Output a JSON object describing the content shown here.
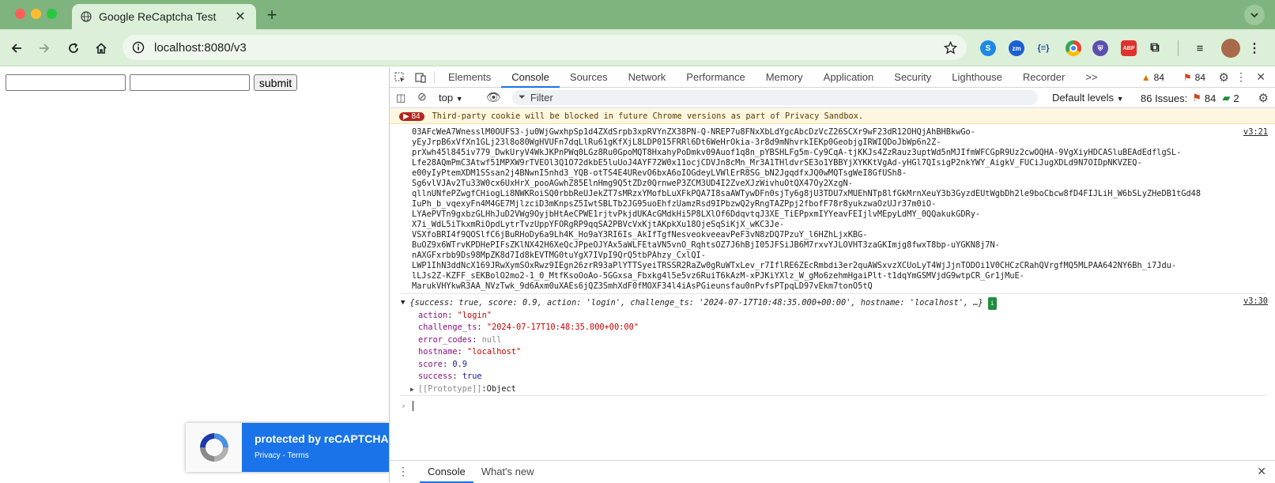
{
  "browser": {
    "tab_title": "Google ReCaptcha Test",
    "url": "localhost:8080/v3"
  },
  "page": {
    "submit_label": "submit",
    "recaptcha": {
      "title": "protected by reCAPTCHA",
      "links": "Privacy - Terms"
    }
  },
  "devtools": {
    "tabs": [
      "Elements",
      "Console",
      "Sources",
      "Network",
      "Performance",
      "Memory",
      "Application",
      "Security",
      "Lighthouse",
      "Recorder"
    ],
    "more_tabs": ">>",
    "warnings_count": "84",
    "errors_count": "84",
    "context": "top",
    "filter_placeholder": "Filter",
    "levels": "Default levels",
    "issues_label": "86 Issues:",
    "issues_errors": "84",
    "issues_info": "2",
    "cookie_badge": "84",
    "cookie_message": "Third-party cookie will be blocked in future Chrome versions as part of Privacy Sandbox.",
    "token_source": "v3:21",
    "token_lines": [
      "03AFcWeA7WnesslM0OUFS3-ju0WjGwxhpSp1d4ZXdSrpb3xpRVYnZX38PN-Q-NREP7u8FNxXbLdYgcAbcDzVcZ26SCXr9wF23dR12OHQjAhBHBkwGo-",
      "yEyJrpB6xVfXn1GLj23l8o80WgHVUFn7dqLlRu61gKfXjL8LDP015FRRl6Dt6WeHrOkia-3r8d9mNhvrkIEKp0GeobjgIRWIQDoJbWp6n2Z-",
      "prXwh45l845iv779_DwkUryV4WkJKPnPWq0LGz8Ru0GpoMQT8HxahyPoDmkv09Auof1q8n_pYBSHLFg5m-Cy9CqA-tjKKJs4ZzRauz3uptWd5nMJIfmWFCGpR9Uz2cwOQHA-9VgXiyHDCASluBEAdEdflgSL-",
      "Lfe28AQmPmC3Atwf51MPXW9rTVEOl3Q1O72dkbE5luUoJ4AYF72W0x11ocjCDVJn8cMn_Mr3A1THldvrSE3o1YBBYjXYKKtVgAd-yHGl7QIsigP2nkYWY_AigkV_FUCiJugXDLd9N7OIDpNKVZEQ-",
      "e00yIyPtemXDM1SSsan2j4BNwnI5nhd3_YQB-otTS4E4URevO6bxA6oIOGdeyLVWlErR8SG_bN2JgqdfxJQ0wMQTsgWeI8GfUSh8-",
      "Sg6vlVJAv2Tu33W0cx6UxHrX_pooAGwhZ85ElnHmg9Q5tZDz0QrnweP3ZCM3UD4I2ZveXJzWivhuOtQX47Oy2XzgN-",
      "qllnUNfePZwgfCHiogLi8NWKRoiSQ0rbbReUJekZT7sMRzxYMofbLuXFkPQA7I8saAWTywDFn0sjTy6g8jU3TDU7xMUEhNTp8lfGkMrnXeuY3b3GyzdEUtWgbDh2le9boCbcw8fD4FIJLiH_W6bSLyZHeDB1tGd48",
      "IuPh_b_vqexyFn4M4GE7MjlzciD3mKnpsZ5IwtSBLTb2JG95uoEhfzUamzRsd9IPbzwQ2yRngTAZPpj2fbofF78r8yukzwaOzUJr37m0iO-",
      "LYAePVTn9gxbzGLHhJuD2VWg9OyjbHtAeCPWE1rjtvPkjdUKAcGMdkHi5P8LXlOf6DdqvtqJ3XE_TiEPpxmIYYeavFEIjlvMEpyLdMY_0QQakukGDRy-",
      "X7i_WdL5iTkxmRiOpdLytrTvzUppYFORgRP9qqSA2PBVcVxKjtAKpkXu18OjeSqSiKjX_wKC3Je-",
      "VSXfoBRI4f9QOSlfC6jBuRHoDy6a9Lh4K_Ho9aY3RI6Is_AkIfTgfNesveokveeavPeF3vN8zDQ7PzuY_l6HZhLjxKBG-",
      "BuOZ9x6WTrvKPDHePIFsZKlNX42H6XeQcJPpeOJYAx5aWLFEtaVN5vnO_RqhtsOZ7J6hBjI05JFSiJB6M7rxvYJLOVHT3zaGKImjg8fwxT8bp-uYGKN8j7N-",
      "nAXGFxrbb9Ds98MpZK8d7Id8kEVTMG0tuYgX7IVpI9QrQ5tbPAhzy_CxlQI-",
      "LWP1IhN3ddNcX169JRwXymSOxRwz9IEgn26zrR93aPlYTTSyeiTRSSR2RaZw0gRuWTxLev_r7IflRE6ZEcRmbdi3er2quAWSxvzXCUoLyT4WjJjnTODOi1V0CHCzCRahQVrgfMQ5MLPAA642NY6Bh_i7Jdu-",
      "lLJs2Z-KZFF_sEKBolO2mo2-1_0_MtfKsoOoAo-5GGxsa_Fbxkg4l5e5vz6RuiT6kAzM-xPJKiYXlz_W_gMo6zehmHgaiPlt-t1dqYmGSMVjdG9wtpCR_Gr1jMuE-",
      "MarukVHYkwR3AA_NVzTwk_9d6Axm0uXAEs6jQZ3SmhXdF0fMOXF34l4iAsPGieunsfau0nPvfsPTpqLD97vEkm7tonO5tQ"
    ],
    "object_source": "v3:30",
    "object_summary": "{success: true, score: 0.9, action: 'login', challenge_ts: '2024-07-17T10:48:35.000+00:00', hostname: 'localhost', …}",
    "object_props": [
      {
        "key": "action",
        "value": "\"login\"",
        "type": "string"
      },
      {
        "key": "challenge_ts",
        "value": "\"2024-07-17T10:48:35.000+00:00\"",
        "type": "string"
      },
      {
        "key": "error_codes",
        "value": "null",
        "type": "null"
      },
      {
        "key": "hostname",
        "value": "\"localhost\"",
        "type": "string"
      },
      {
        "key": "score",
        "value": "0.9",
        "type": "number"
      },
      {
        "key": "success",
        "value": "true",
        "type": "number"
      }
    ],
    "prototype_label": "[[Prototype]]",
    "prototype_value": "Object",
    "drawer_tabs": [
      "Console",
      "What's new"
    ]
  },
  "colors": {
    "tab_strip": "#7fb47e",
    "toolbar": "#dbefd9",
    "recaptcha_blue": "#1a73e8",
    "error_red": "#b3261e",
    "warning_orange": "#e37400"
  }
}
